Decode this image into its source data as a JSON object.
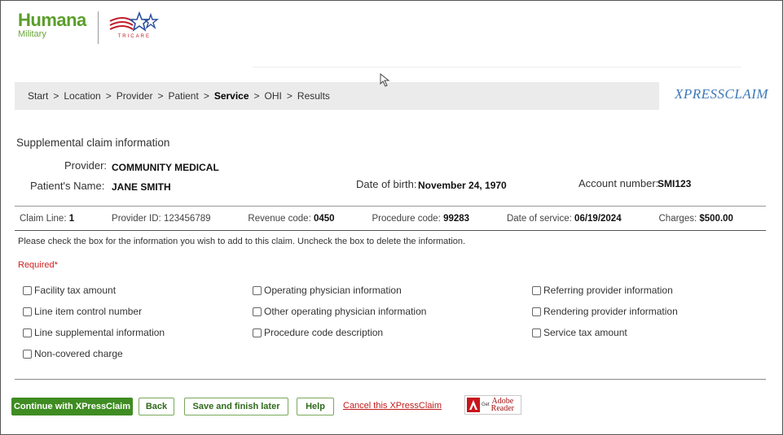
{
  "brand": {
    "humana": "Humana",
    "military": "Military",
    "tricare": "TRICARE",
    "xpressclaim": "XPRESSCLAIM",
    "colors": {
      "green": "#5a9e2a",
      "tricare_red": "#c0202a",
      "tricare_blue": "#2a4f9e",
      "link_red": "#c01b1b"
    }
  },
  "breadcrumb": [
    {
      "label": "Start",
      "active": false
    },
    {
      "label": "Location",
      "active": false
    },
    {
      "label": "Provider",
      "active": false
    },
    {
      "label": "Patient",
      "active": false
    },
    {
      "label": "Service",
      "active": true
    },
    {
      "label": "OHI",
      "active": false
    },
    {
      "label": "Results",
      "active": false
    }
  ],
  "breadcrumb_separator": ">",
  "section_title": "Supplemental claim information",
  "provider": {
    "label": "Provider:",
    "value": "COMMUNITY MEDICAL"
  },
  "patient": {
    "label": "Patient's Name:",
    "value": "JANE SMITH"
  },
  "dob": {
    "label": "Date of birth:",
    "value": "November 24, 1970"
  },
  "account": {
    "label": "Account number:",
    "value": "SMI123"
  },
  "claim_line": {
    "line_label": "Claim Line:",
    "line_value": "1",
    "provider_id_label": "Provider ID:",
    "provider_id_value": "123456789",
    "revenue_label": "Revenue code:",
    "revenue_value": "0450",
    "procedure_label": "Procedure code:",
    "procedure_value": "99283",
    "dos_label": "Date of service:",
    "dos_value": "06/19/2024",
    "charges_label": "Charges:",
    "charges_value": "$500.00"
  },
  "instruction": "Please check the box for the information you wish to add to this claim. Uncheck the box to delete the information.",
  "required": "Required*",
  "checkboxes": [
    "Facility tax amount",
    "Line item control number",
    "Line supplemental information",
    "Non-covered charge",
    "Operating physician information",
    "Other operating physician information",
    "Procedure code description",
    "Referring provider information",
    "Rendering provider information",
    "Service tax amount"
  ],
  "buttons": {
    "continue": "Continue with XPressClaim",
    "back": "Back",
    "save": "Save and finish later",
    "help": "Help",
    "cancel": "Cancel this XPressClaim"
  },
  "adobe": {
    "get": "Get",
    "adobe": "Adobe",
    "reader": "Reader"
  }
}
